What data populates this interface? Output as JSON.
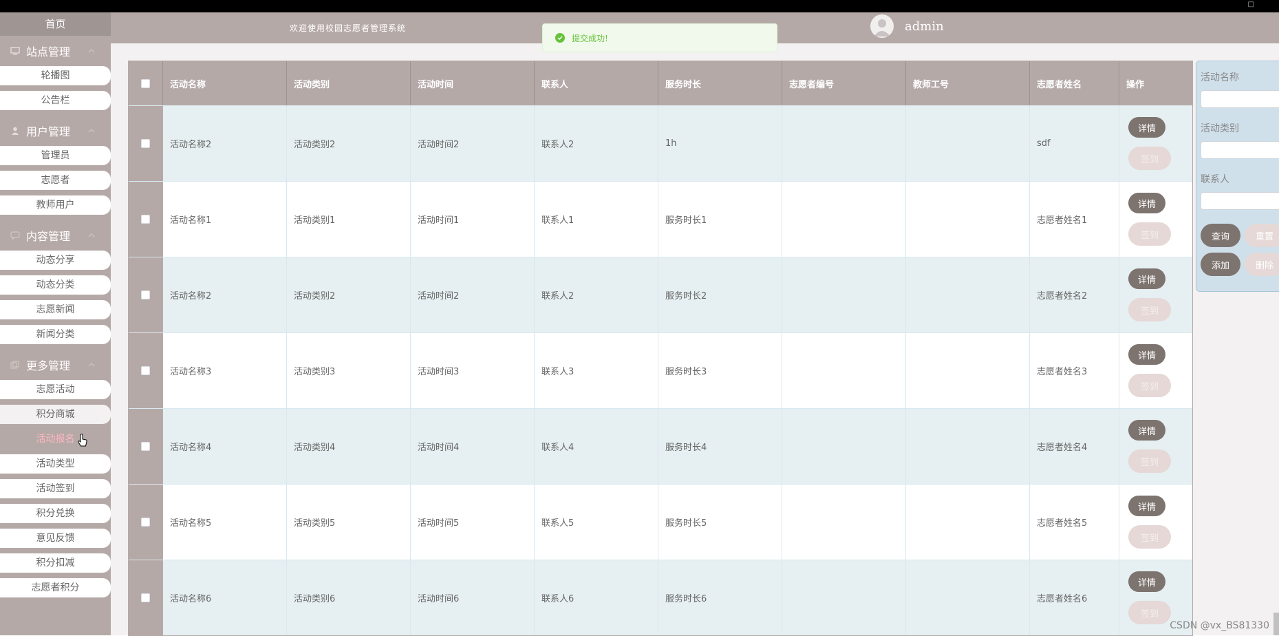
{
  "header": {
    "welcome": "欢迎使用校园志愿者管理系统",
    "username": "admin",
    "toast": "提交成功!"
  },
  "sidebar": {
    "home": "首页",
    "groups": [
      {
        "title": "站点管理",
        "items": [
          "轮播图",
          "公告栏"
        ]
      },
      {
        "title": "用户管理",
        "items": [
          "管理员",
          "志愿者",
          "教师用户"
        ]
      },
      {
        "title": "内容管理",
        "items": [
          "动态分享",
          "动态分类",
          "志愿新闻",
          "新闻分类"
        ]
      },
      {
        "title": "更多管理",
        "items": [
          "志愿活动",
          "积分商城",
          "活动报名",
          "活动类型",
          "活动签到",
          "积分兑换",
          "意见反馈",
          "积分扣减",
          "志愿者积分"
        ]
      }
    ]
  },
  "table": {
    "columns": [
      "活动名称",
      "活动类别",
      "活动时间",
      "联系人",
      "服务时长",
      "志愿者编号",
      "教师工号",
      "志愿者姓名",
      "操作"
    ],
    "rows": [
      [
        "活动名称2",
        "活动类别2",
        "活动时间2",
        "联系人2",
        "1h",
        "",
        "",
        "sdf"
      ],
      [
        "活动名称1",
        "活动类别1",
        "活动时间1",
        "联系人1",
        "服务时长1",
        "",
        "",
        "志愿者姓名1"
      ],
      [
        "活动名称2",
        "活动类别2",
        "活动时间2",
        "联系人2",
        "服务时长2",
        "",
        "",
        "志愿者姓名2"
      ],
      [
        "活动名称3",
        "活动类别3",
        "活动时间3",
        "联系人3",
        "服务时长3",
        "",
        "",
        "志愿者姓名3"
      ],
      [
        "活动名称4",
        "活动类别4",
        "活动时间4",
        "联系人4",
        "服务时长4",
        "",
        "",
        "志愿者姓名4"
      ],
      [
        "活动名称5",
        "活动类别5",
        "活动时间5",
        "联系人5",
        "服务时长5",
        "",
        "",
        "志愿者姓名5"
      ],
      [
        "活动名称6",
        "活动类别6",
        "活动时间6",
        "联系人6",
        "服务时长6",
        "",
        "",
        "志愿者姓名6"
      ]
    ],
    "detail_label": "详情",
    "sign_label": "签到"
  },
  "search": {
    "labels": [
      "活动名称",
      "活动类别",
      "联系人"
    ],
    "query": "查询",
    "reset": "重置",
    "add": "添加",
    "delete": "删除"
  },
  "watermark": "CSDN @vx_BS81330",
  "colors": {
    "theme": "#b5a9a7",
    "dark_button": "#7d746f",
    "light_button": "#e5d8d6",
    "row_alt": "#e6eff2",
    "active_text": "#ffb6c1",
    "success": "#67c23a"
  }
}
